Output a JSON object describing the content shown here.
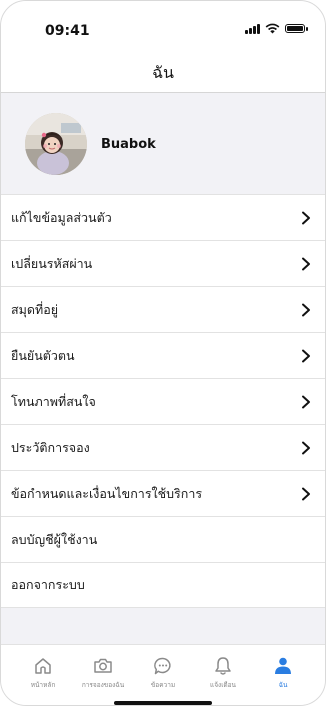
{
  "status_bar": {
    "time": "09:41"
  },
  "header": {
    "title": "ฉัน"
  },
  "profile": {
    "name": "Buabok"
  },
  "menu": {
    "items": [
      {
        "label": "แก้ไขข้อมูลส่วนตัว",
        "has_chevron": true
      },
      {
        "label": "เปลี่ยนรหัสผ่าน",
        "has_chevron": true
      },
      {
        "label": "สมุดที่อยู่",
        "has_chevron": true
      },
      {
        "label": "ยืนยันตัวตน",
        "has_chevron": true
      },
      {
        "label": "โทนภาพที่สนใจ",
        "has_chevron": true
      },
      {
        "label": "ประวัติการจอง",
        "has_chevron": true
      },
      {
        "label": "ข้อกำหนดและเงื่อนไขการใช้บริการ",
        "has_chevron": true
      },
      {
        "label": "ลบบัญชีผู้ใช้งาน",
        "has_chevron": false
      },
      {
        "label": "ออกจากระบบ",
        "has_chevron": false
      }
    ]
  },
  "tab_bar": {
    "tabs": [
      {
        "label": "หน้าหลัก",
        "icon": "home-icon",
        "active": false
      },
      {
        "label": "การจองของฉัน",
        "icon": "camera-icon",
        "active": false
      },
      {
        "label": "ข้อความ",
        "icon": "chat-icon",
        "active": false
      },
      {
        "label": "แจ้งเตือน",
        "icon": "bell-icon",
        "active": false
      },
      {
        "label": "ฉัน",
        "icon": "person-icon",
        "active": true
      }
    ]
  },
  "colors": {
    "accent": "#2a7de1",
    "inactive_icon": "#8a8a8a",
    "background": "#f2f2f6"
  }
}
